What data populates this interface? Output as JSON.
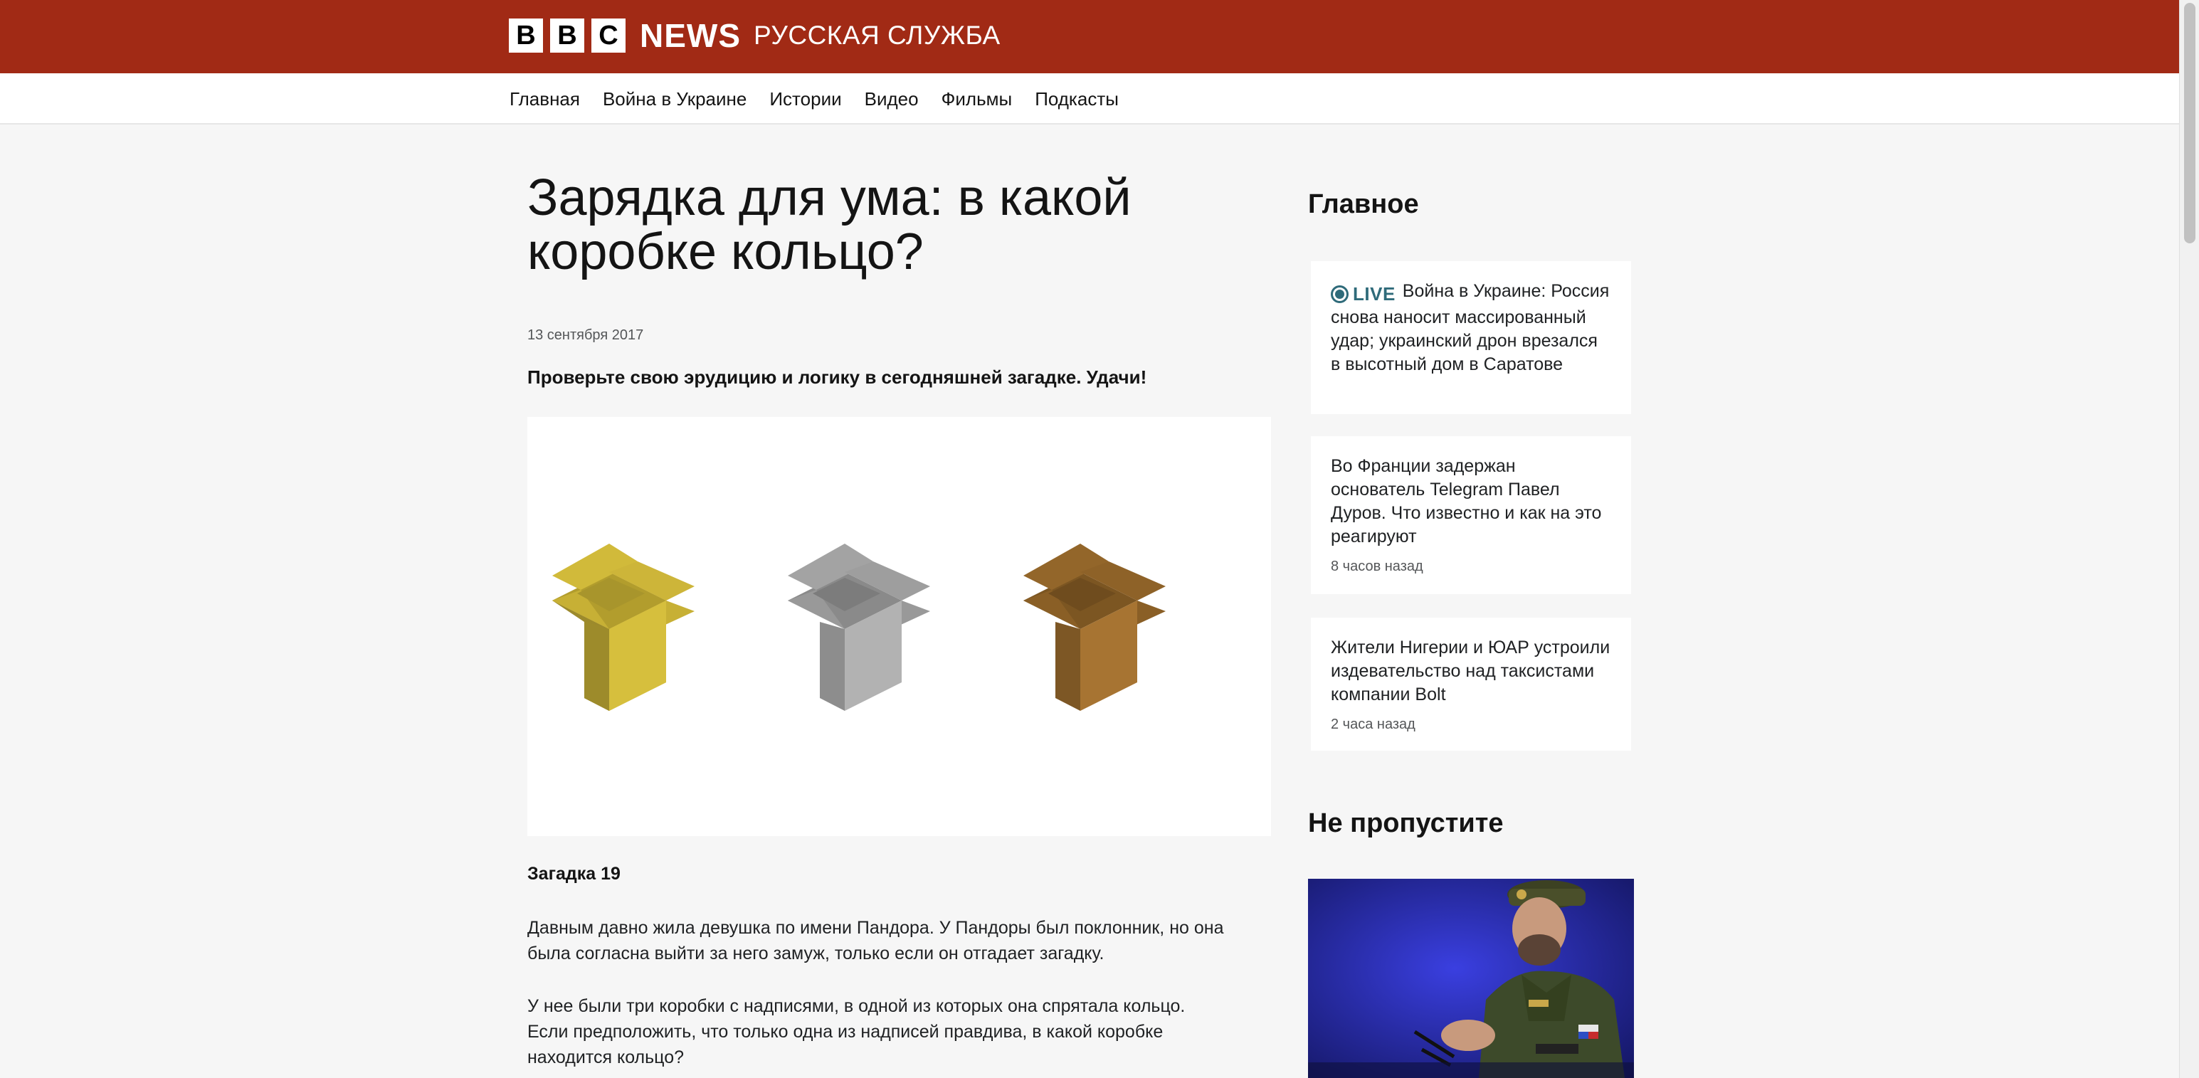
{
  "header": {
    "bbc_letters": [
      "B",
      "B",
      "C"
    ],
    "news_word": "NEWS",
    "service_name": "РУССКАЯ СЛУЖБА"
  },
  "nav": {
    "items": [
      {
        "label": "Главная"
      },
      {
        "label": "Война в Украине"
      },
      {
        "label": "Истории"
      },
      {
        "label": "Видео"
      },
      {
        "label": "Фильмы"
      },
      {
        "label": "Подкасты"
      }
    ]
  },
  "article": {
    "headline": "Зарядка для ума: в какой коробке кольцо?",
    "date": "13 сентября 2017",
    "lead": "Проверьте свою эрудицию и логику в сегодняшней загадке. Удачи!",
    "figure": {
      "boxes": [
        {
          "name": "gold-box",
          "color": "#d4bd3c"
        },
        {
          "name": "silver-box",
          "color": "#a9a9a9"
        },
        {
          "name": "bronze-box",
          "color": "#a77432"
        }
      ]
    },
    "riddle_title": "Загадка 19",
    "paragraphs": [
      "Давным давно жила девушка по имени Пандора. У Пандоры был поклонник, но она была согласна выйти за него замуж, только если он отгадает загадку.",
      "У нее были три коробки с надписями, в одной из которых она спрятала кольцо. Если предположить, что только одна из надписей правдива, в какой коробке находится кольцо?"
    ]
  },
  "sidebar": {
    "top_heading": "Главное",
    "cards": [
      {
        "live_label": "LIVE",
        "title": "Война в Украине: Россия снова наносит массированный удар; украинский дрон врезался в высотный дом в Саратове",
        "time": ""
      },
      {
        "live_label": "",
        "title": "Во Франции задержан основатель Telegram Павел Дуров. Что известно и как на это реагируют",
        "time": "8 часов назад"
      },
      {
        "live_label": "",
        "title": "Жители Нигерии и ЮАР устроили издевательство над таксистами компании Bolt",
        "time": "2 часа назад"
      }
    ],
    "dont_miss_heading": "Не пропустите"
  },
  "colors": {
    "brand_red": "#a12a15",
    "live_teal": "#2f6b7a",
    "page_bg": "#f6f6f6"
  }
}
